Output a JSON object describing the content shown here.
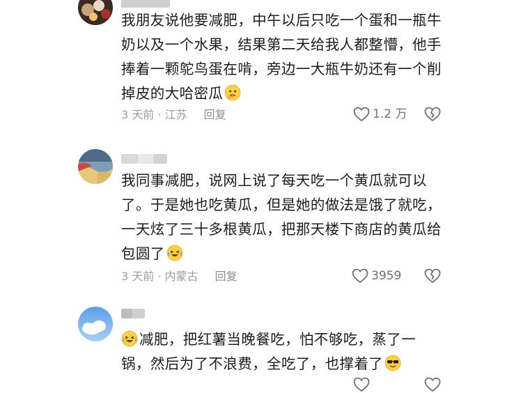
{
  "comments": [
    {
      "text_lines": [
        "我朋友说他要减肥，中午以后只吃一个蛋和一瓶牛",
        "奶以及一个水果，结果第二天给我人都整懵，他手",
        "捧着一颗鸵鸟蛋在啃，旁边一大瓶牛奶还有一个削",
        "掉皮的大哈密瓜"
      ],
      "meta": "3 天前 · 江苏",
      "reply_label": "回复",
      "like_count": "1.2 万",
      "emoji": "thinking-face"
    },
    {
      "text_lines": [
        "我同事减肥，说网上说了每天吃一个黄瓜就可以",
        "了。于是她也吃黄瓜，但是她的做法是饿了就吃，",
        "一天炫了三十多根黄瓜，把那天楼下商店的黄瓜给",
        "包圆了"
      ],
      "meta": "3 天前 · 内蒙古",
      "reply_label": "回复",
      "like_count": "3959",
      "emoji": "crying-laughing-face"
    },
    {
      "text_lines": [
        "减肥，把红薯当晚餐吃，怕不够吃，蒸了一",
        "锅，然后为了不浪费，全吃了，也撑着了"
      ],
      "emoji_lead": "crying-laughing-face",
      "emoji": "sunglasses-face"
    }
  ],
  "colors": {
    "text": "#1c1c1c",
    "meta": "#9d9d9d",
    "icon": "#707070"
  }
}
